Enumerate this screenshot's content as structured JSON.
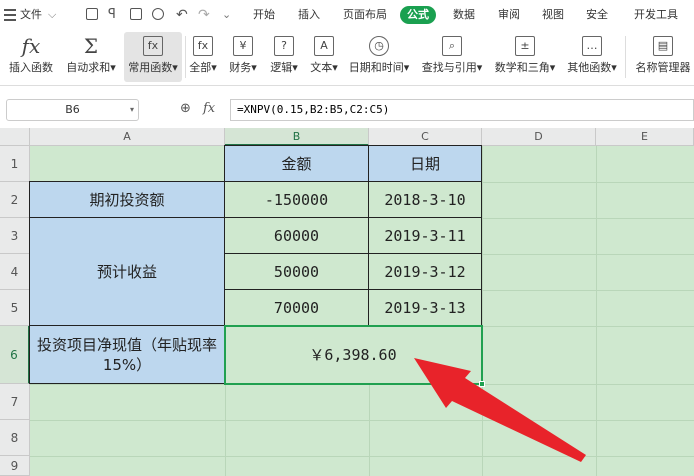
{
  "menubar": {
    "file": "文件",
    "tabs": [
      "开始",
      "插入",
      "页面布局",
      "公式",
      "数据",
      "审阅",
      "视图",
      "安全",
      "开发工具"
    ],
    "active_tab": "公式"
  },
  "ribbon": {
    "insert_function": "插入函数",
    "autosum": "自动求和",
    "common_functions": "常用函数",
    "all": "全部",
    "finance": "财务",
    "logic": "逻辑",
    "text": "文本",
    "datetime": "日期和时间",
    "lookup": "查找与引用",
    "math": "数学和三角",
    "other": "其他函数",
    "name_manager": "名称管理器"
  },
  "formula_bar": {
    "name_box": "B6",
    "fx": "fx",
    "formula": "=XNPV(0.15,B2:B5,C2:C5)"
  },
  "sheet": {
    "columns": [
      "A",
      "B",
      "C",
      "D",
      "E"
    ],
    "rows": [
      "1",
      "2",
      "3",
      "4",
      "5",
      "6",
      "7",
      "8",
      "9"
    ],
    "active_cell": "B6",
    "cells": {
      "B1": "金额",
      "C1": "日期",
      "A2": "期初投资额",
      "B2": "-150000",
      "C2": "2018-3-10",
      "A3": "预计收益",
      "B3": "60000",
      "C3": "2019-3-11",
      "B4": "50000",
      "C4": "2019-3-12",
      "B5": "70000",
      "C5": "2019-3-13",
      "A6": "投资项目净现值（年贴现率15%）",
      "B6": "￥6,398.60"
    }
  },
  "colors": {
    "sheet_bg": "#cfe8cf",
    "label_fill": "#bdd7ee",
    "accent_green": "#1aa050",
    "arrow_red": "#e8232a"
  }
}
